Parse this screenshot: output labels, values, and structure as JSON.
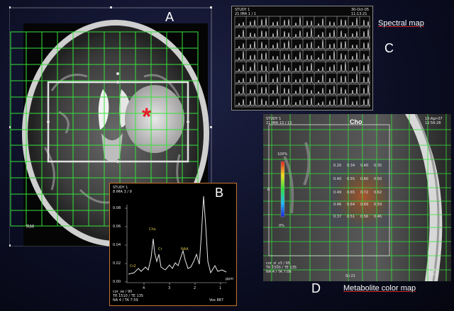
{
  "panels": {
    "a": {
      "label": "A",
      "overlay_label": "RM",
      "marker": "*"
    },
    "b": {
      "label": "B",
      "header": "STUDY 1\n8 IMA 3 / 9",
      "footer": "cor_se / 90\nTR 1510 / TE 135\nNA 4 / TA 7:59",
      "footer_right": "Vox 887",
      "yticks": [
        "0.08",
        "0.06",
        "0.04",
        "0.02",
        "0.00"
      ],
      "xticks": [
        "4",
        "3",
        "2",
        "1"
      ],
      "xunit": "ppm",
      "peaks": [
        "Cr2",
        "Cho",
        "Cr",
        "NAA"
      ]
    },
    "c": {
      "label": "C",
      "caption": "Spectral map",
      "header_left": "STUDY 1\n21 IMA 1 / 1",
      "header_right": "30-Oct-05\n11:13:21"
    },
    "d": {
      "label": "D",
      "caption": "Metabolite color map",
      "metabolite": "Cho",
      "header_left": "STUDY 1\n21 IMA 13 / 13",
      "header_right": "10-Apr-07\n12:56:28",
      "scale_top": "100%",
      "scale_bottom": "0%",
      "side_mark": "R",
      "footer_left": "cor_sl_z3 / 95\nTR 1500 / TE 135\nNA 4 / TA 7:06",
      "footer_center": "Sli 21",
      "footer_right": "L_Be\n5.61",
      "values": [
        [
          "0.20",
          "0.34",
          "0.40",
          "0.35"
        ],
        [
          "0.40",
          "0.55",
          "0.60",
          "0.50"
        ],
        [
          "0.49",
          "0.65",
          "0.72",
          "0.62"
        ],
        [
          "0.46",
          "0.64",
          "0.69",
          "0.59"
        ],
        [
          "0.37",
          "0.51",
          "0.56",
          "0.46"
        ]
      ]
    }
  },
  "colors": {
    "grid": "#35e23a",
    "roi": "#e0e0e0",
    "marker": "#e8202a",
    "caption_underline": "#d0242a"
  }
}
